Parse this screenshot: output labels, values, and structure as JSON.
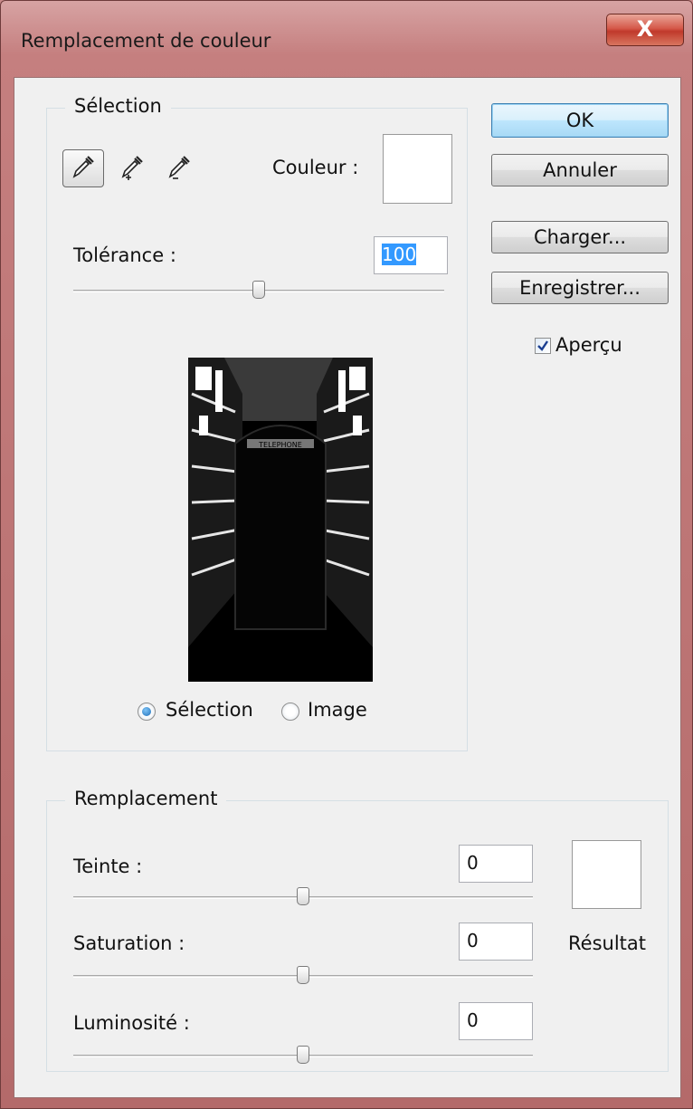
{
  "window": {
    "title": "Remplacement de couleur",
    "close_label": "X"
  },
  "selection_group": {
    "label": "Sélection",
    "tools": [
      "eyedropper-icon",
      "eyedropper-plus-icon",
      "eyedropper-minus-icon"
    ],
    "color_label": "Couleur :",
    "color_swatch": "#ffffff",
    "tolerance_label": "Tolérance :",
    "tolerance_value": "100",
    "tolerance_level": 0.5,
    "preview_text": "TELEPHONE",
    "view_options": [
      {
        "label": "Sélection",
        "checked": true
      },
      {
        "label": "Image",
        "checked": false
      }
    ]
  },
  "buttons": {
    "ok": "OK",
    "cancel": "Annuler",
    "load": "Charger...",
    "save": "Enregistrer..."
  },
  "preview_checkbox": {
    "label": "Aperçu",
    "checked": true
  },
  "replacement_group": {
    "label": "Remplacement",
    "hue_label": "Teinte :",
    "hue_value": "0",
    "saturation_label": "Saturation :",
    "saturation_value": "0",
    "lightness_label": "Luminosité :",
    "lightness_value": "0",
    "result_label": "Résultat",
    "result_swatch": "#ffffff"
  }
}
